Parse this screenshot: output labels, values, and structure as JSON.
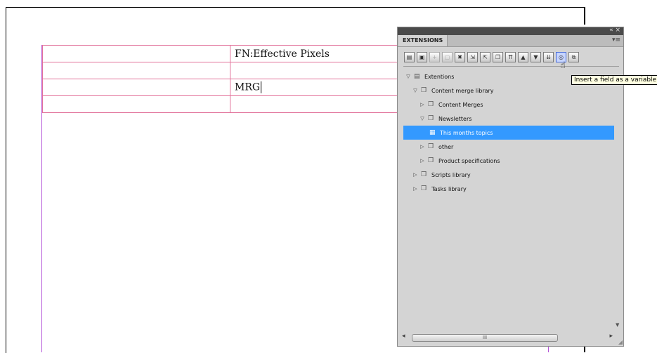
{
  "document": {
    "table": {
      "rows": [
        [
          "",
          "FN:Effective Pixels"
        ],
        [
          "",
          ""
        ],
        [
          "",
          "MRG"
        ],
        [
          "",
          ""
        ]
      ]
    }
  },
  "extensions_panel": {
    "tab_label": "EXTENSIONS",
    "window_controls": "«  ×",
    "menu_icon": "panel-menu-icon",
    "toolbar_icons": [
      "new-document-icon",
      "save-icon",
      "add-icon",
      "disabled-icon",
      "delete-icon",
      "import-icon",
      "export-icon",
      "copy-icon",
      "move-top-icon",
      "move-up-icon",
      "move-down-icon",
      "move-bottom-icon",
      "insert-field-icon",
      "merge-icon"
    ],
    "tooltip": "Insert a field as a variable",
    "tree": [
      {
        "label": "Extentions",
        "icon": "library-icon",
        "expanded": true,
        "indent": 0
      },
      {
        "label": "Content merge library",
        "icon": "folder-icon",
        "expanded": true,
        "indent": 1
      },
      {
        "label": "Content Merges",
        "icon": "folder-icon",
        "expanded": false,
        "indent": 2
      },
      {
        "label": "Newsletters",
        "icon": "folder-icon",
        "expanded": true,
        "indent": 2
      },
      {
        "label": "This months topics",
        "icon": "document-icon",
        "selected": true,
        "indent": 3
      },
      {
        "label": "other",
        "icon": "folder-icon",
        "expanded": false,
        "indent": 2
      },
      {
        "label": "Product specifications",
        "icon": "folder-icon",
        "expanded": false,
        "indent": 2
      },
      {
        "label": "Scripts library",
        "icon": "folder-icon",
        "expanded": false,
        "indent": 1
      },
      {
        "label": "Tasks library",
        "icon": "folder-icon",
        "expanded": false,
        "indent": 1
      }
    ],
    "hscroll_thumb": "III"
  },
  "colors": {
    "table_border": "#e2729a",
    "margin_guide": "#b455d8",
    "selection": "#3399ff",
    "tooltip_bg": "#ffffe1"
  }
}
